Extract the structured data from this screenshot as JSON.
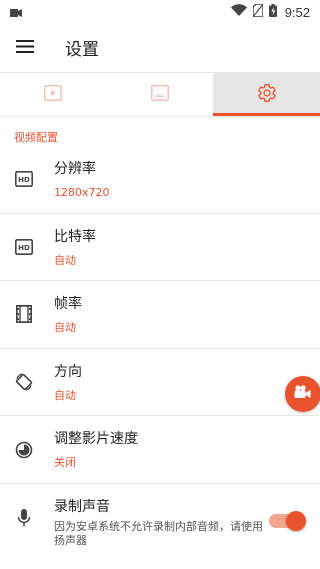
{
  "status_bar": {
    "time": "9:52",
    "icons": [
      "sim-icon",
      "wifi-icon",
      "no-sim-icon",
      "battery-icon"
    ]
  },
  "app_bar": {
    "title": "设置",
    "menu_icon": "hamburger-menu-icon"
  },
  "tabs": [
    {
      "icon": "video-play-icon",
      "active": false
    },
    {
      "icon": "image-icon",
      "active": false
    },
    {
      "icon": "gear-icon",
      "active": true
    }
  ],
  "section": {
    "header": "视频配置"
  },
  "settings": [
    {
      "icon": "hd-icon",
      "title": "分辨率",
      "value": "1280x720"
    },
    {
      "icon": "hd-icon",
      "title": "比特率",
      "value": "自动"
    },
    {
      "icon": "film-icon",
      "title": "帧率",
      "value": "自动"
    },
    {
      "icon": "rotate-screen-icon",
      "title": "方向",
      "value": "自动"
    },
    {
      "icon": "speed-icon",
      "title": "调整影片速度",
      "value": "关闭"
    },
    {
      "icon": "microphone-icon",
      "title": "录制声音",
      "description": "因为安卓系统不允许录制内部音频，请使用扬声器",
      "toggle_on": true
    }
  ],
  "fab": {
    "icon": "video-camera-icon"
  },
  "colors": {
    "accent": "#e8532e",
    "active_tab_bg": "#e5e5e5"
  }
}
